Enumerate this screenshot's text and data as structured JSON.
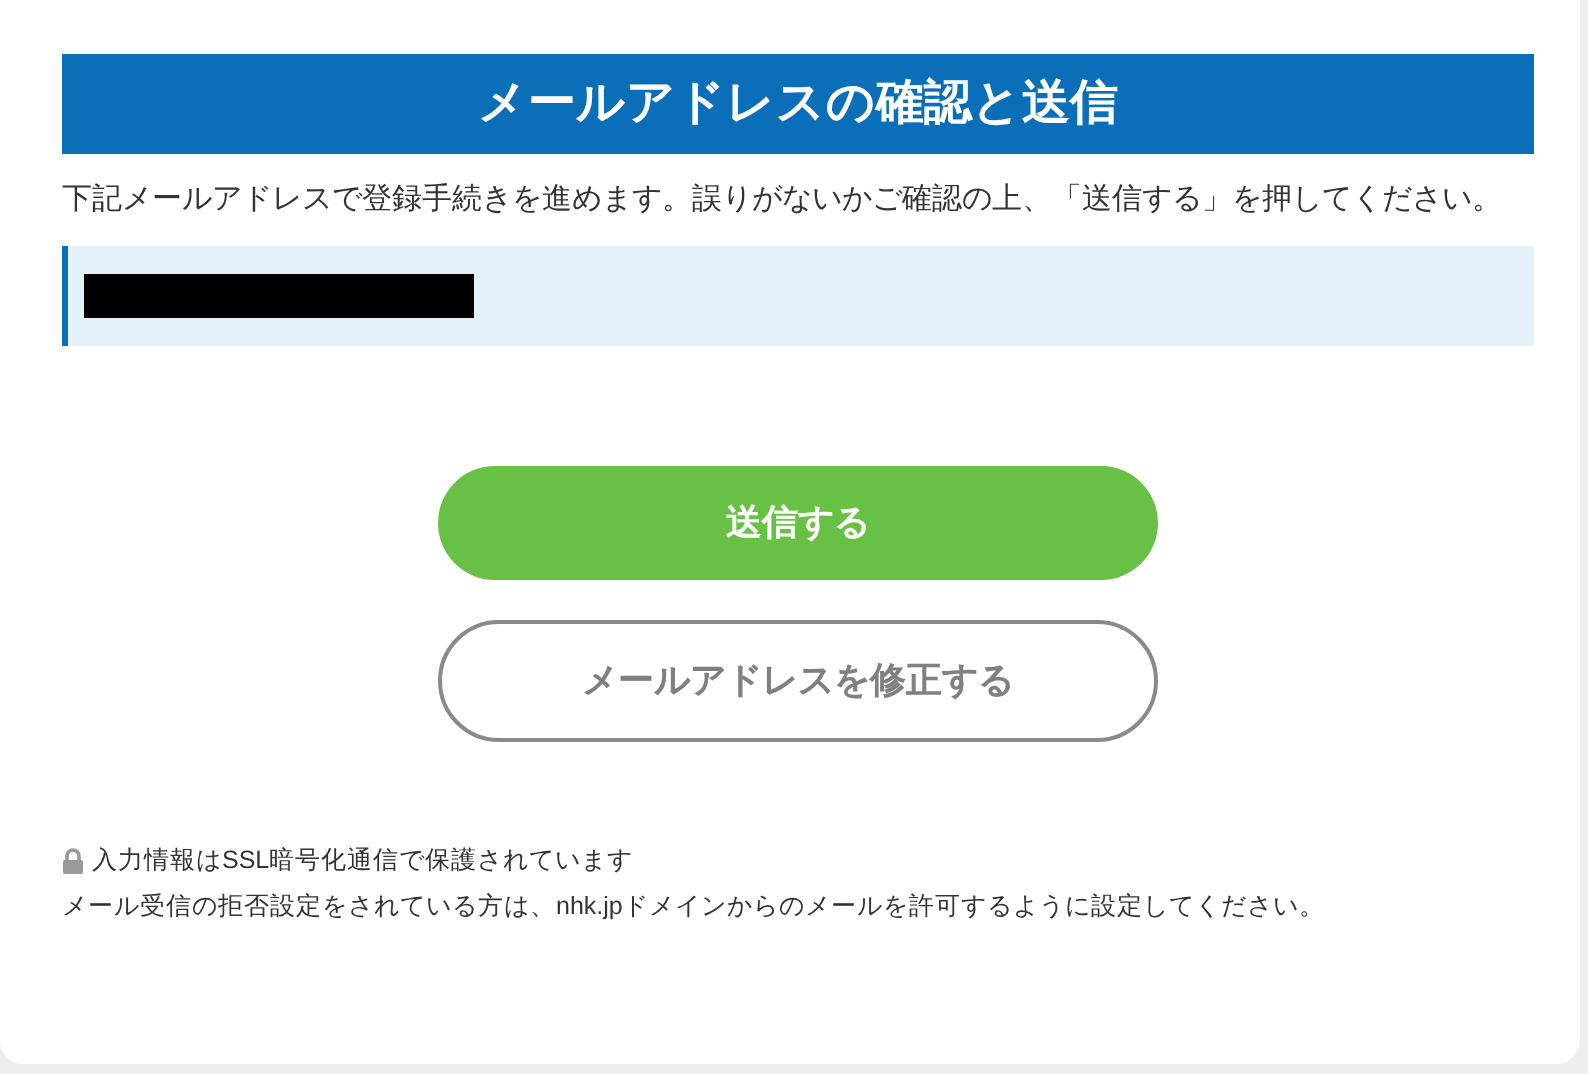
{
  "title": "メールアドレスの確認と送信",
  "description": "下記メールアドレスで登録手続きを進めます。誤りがないかご確認の上、「送信する」を押してください。",
  "email": {
    "redacted": true
  },
  "buttons": [
    {
      "label": "送信する",
      "kind": "primary"
    },
    {
      "label": "メールアドレスを修正する",
      "kind": "secondary"
    }
  ],
  "notes": [
    {
      "text": "入力情報はSSL暗号化通信で保護されています",
      "kind": "secure"
    },
    {
      "text": "メール受信の拒否設定をされている方は、nhk.jpドメインからのメールを許可するように設定してください。",
      "kind": "plain"
    }
  ]
}
